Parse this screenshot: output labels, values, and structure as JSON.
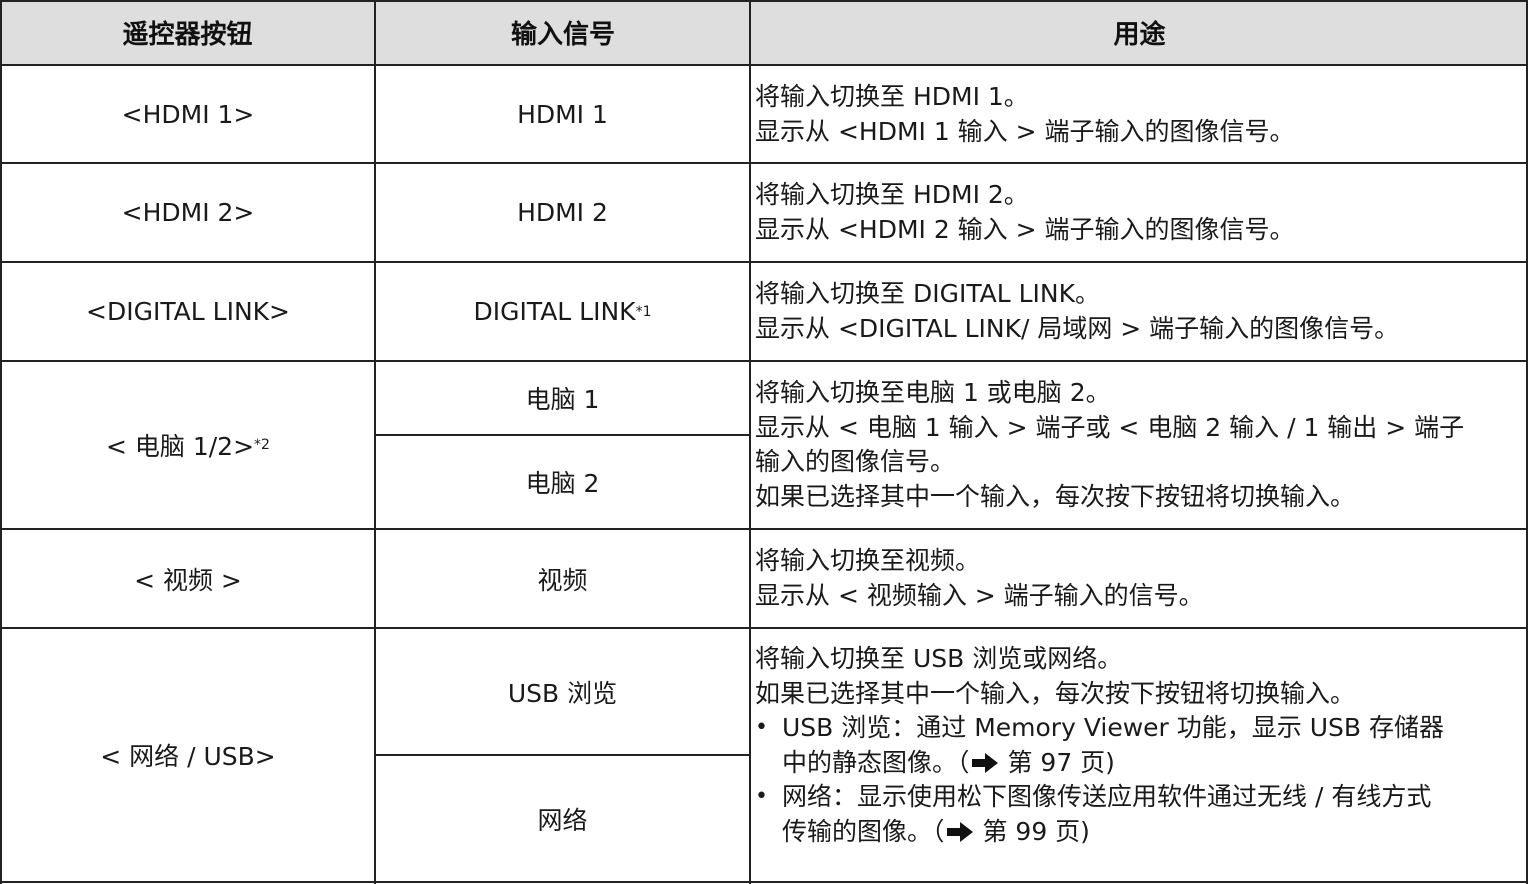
{
  "header": {
    "col1": "遥控器按钮",
    "col2": "输入信号",
    "col3": "用途"
  },
  "rows": [
    {
      "button": "<HDMI 1>",
      "signals": [
        "HDMI 1"
      ],
      "desc": [
        "将输入切换至 HDMI 1。",
        "显示从 <HDMI 1 输入 > 端子输入的图像信号。"
      ]
    },
    {
      "button": "<HDMI 2>",
      "signals": [
        "HDMI 2"
      ],
      "desc": [
        "将输入切换至 HDMI 2。",
        "显示从 <HDMI 2 输入 > 端子输入的图像信号。"
      ]
    },
    {
      "button": "<DIGITAL LINK>",
      "signals": [
        "DIGITAL LINK"
      ],
      "signal_note": "*1",
      "desc": [
        "将输入切换至 DIGITAL LINK。",
        "显示从 <DIGITAL LINK/ 局域网 > 端子输入的图像信号。"
      ]
    },
    {
      "button": "< 电脑 1/2>",
      "button_note": "*2",
      "signals": [
        "电脑 1",
        "电脑 2"
      ],
      "desc": [
        "将输入切换至电脑 1 或电脑 2。",
        "显示从 < 电脑 1 输入 > 端子或 < 电脑 2 输入 / 1 输出 > 端子",
        "输入的图像信号。",
        "如果已选择其中一个输入，每次按下按钮将切换输入。"
      ]
    },
    {
      "button": "< 视频 >",
      "signals": [
        "视频"
      ],
      "desc": [
        "将输入切换至视频。",
        "显示从 < 视频输入 > 端子输入的信号。"
      ]
    },
    {
      "button": "< 网络 / USB>",
      "signals": [
        "USB 浏览",
        "网络"
      ],
      "desc": [
        "将输入切换至 USB 浏览或网络。",
        "如果已选择其中一个输入，每次按下按钮将切换输入。"
      ],
      "bullets": [
        {
          "line1": "USB 浏览：通过 Memory Viewer 功能，显示 USB 存储器",
          "line2_pre": "中的静态图像。（",
          "line2_ref": " 第 97 页)"
        },
        {
          "line1": "网络：显示使用松下图像传送应用软件通过无线 / 有线方式",
          "line2_pre": "传输的图像。（",
          "line2_ref": " 第 99 页)"
        }
      ]
    }
  ],
  "icons": {
    "bullet": "•",
    "reference_arrow": "right-arrow-icon"
  }
}
